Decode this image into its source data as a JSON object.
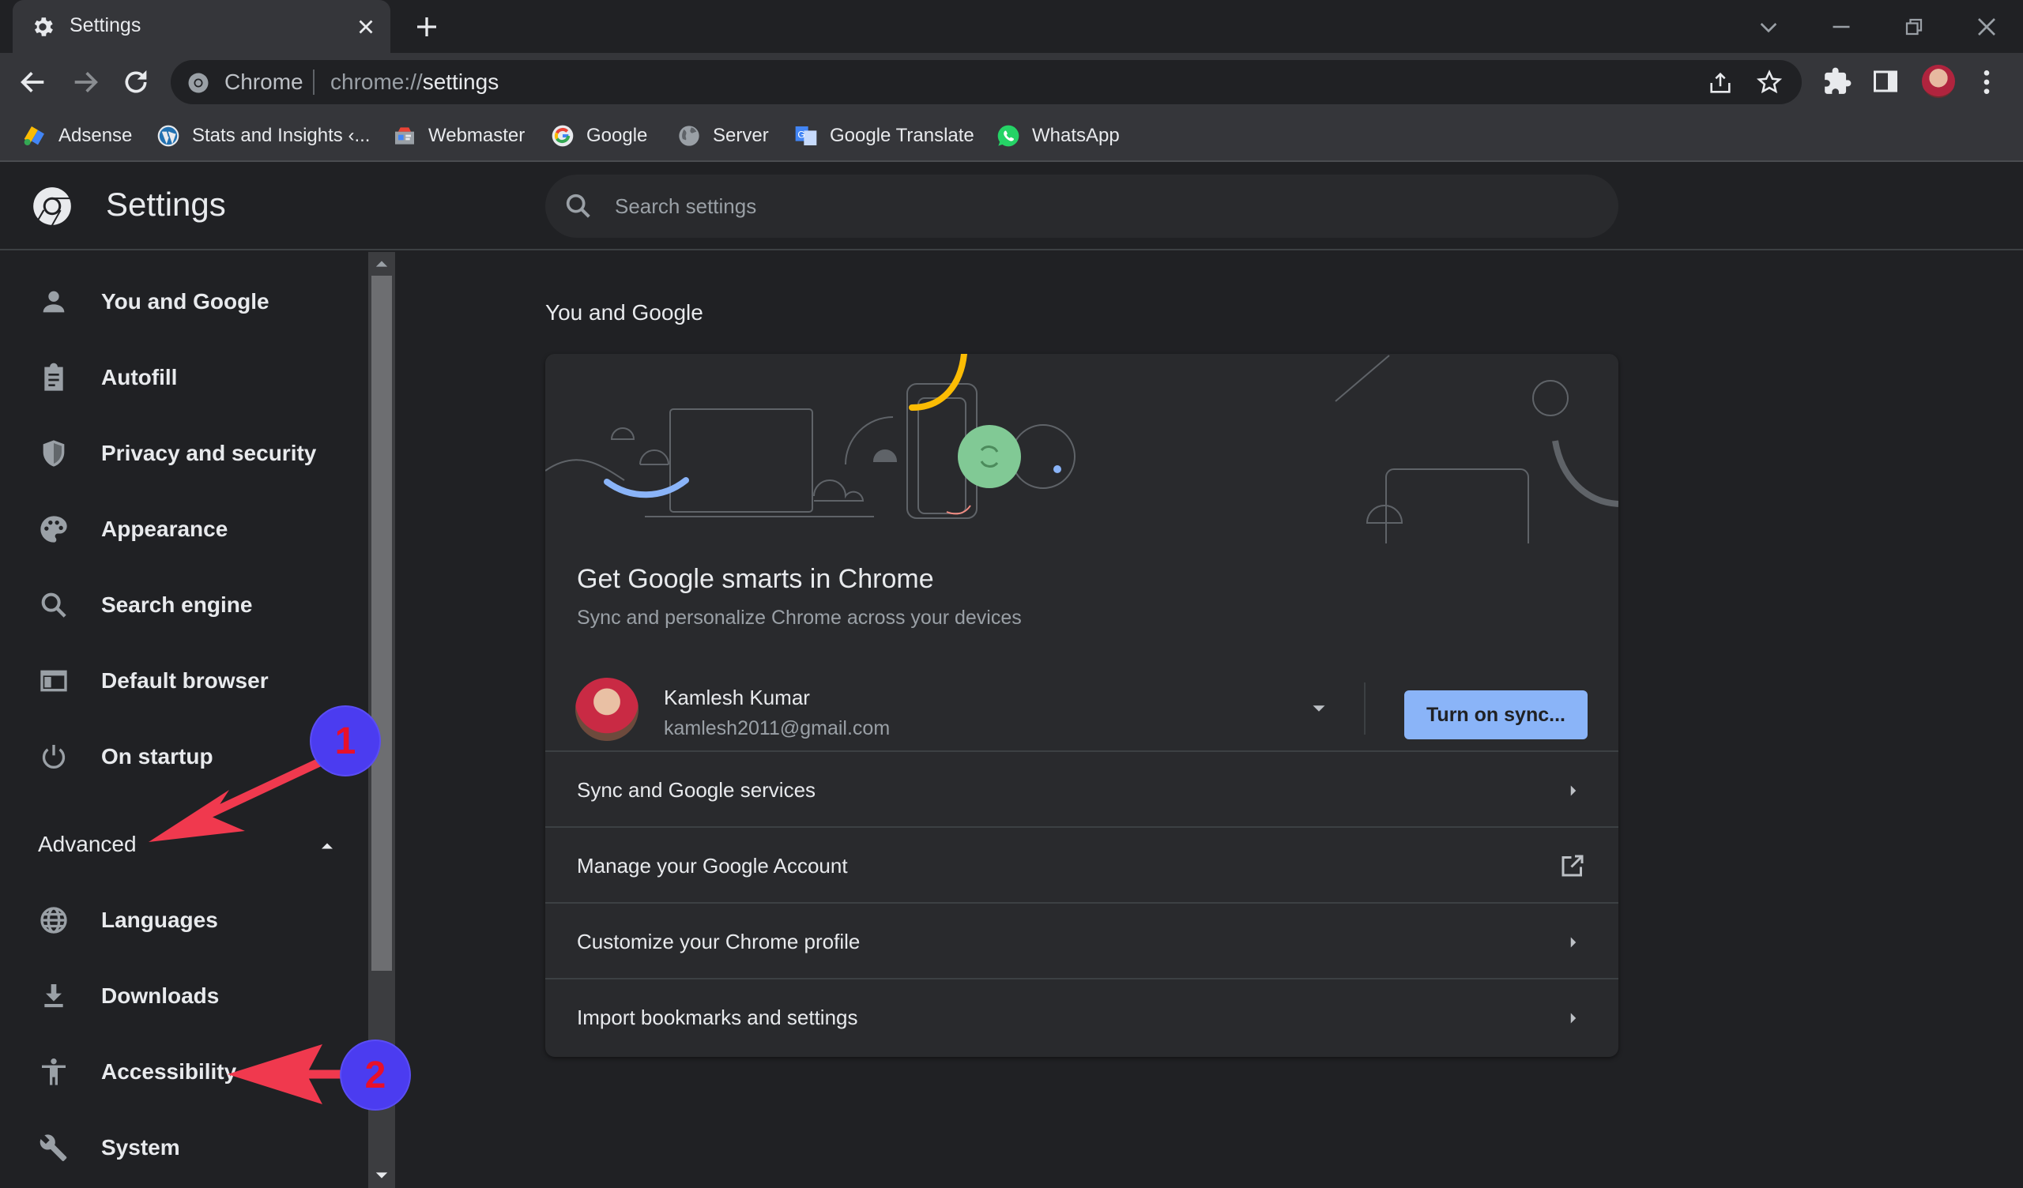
{
  "tab": {
    "title": "Settings",
    "icon": "gear-icon"
  },
  "omnibox": {
    "site_label": "Chrome",
    "url_scheme": "chrome://",
    "url_path": "settings"
  },
  "bookmarks": [
    {
      "label": "Adsense",
      "icon": "adsense-icon"
    },
    {
      "label": "Stats and Insights ‹...",
      "icon": "wordpress-icon"
    },
    {
      "label": "Webmaster",
      "icon": "webmaster-icon"
    },
    {
      "label": "Google",
      "icon": "google-icon"
    },
    {
      "label": "Server",
      "icon": "globe-icon"
    },
    {
      "label": "Google Translate",
      "icon": "translate-icon"
    },
    {
      "label": "WhatsApp",
      "icon": "whatsapp-icon"
    }
  ],
  "header": {
    "title": "Settings",
    "search_placeholder": "Search settings"
  },
  "sidebar": {
    "items": [
      {
        "label": "You and Google",
        "icon": "person-icon"
      },
      {
        "label": "Autofill",
        "icon": "clipboard-icon"
      },
      {
        "label": "Privacy and security",
        "icon": "shield-icon"
      },
      {
        "label": "Appearance",
        "icon": "palette-icon"
      },
      {
        "label": "Search engine",
        "icon": "search-icon"
      },
      {
        "label": "Default browser",
        "icon": "browser-icon"
      },
      {
        "label": "On startup",
        "icon": "power-icon"
      }
    ],
    "advanced_label": "Advanced",
    "advanced_items": [
      {
        "label": "Languages",
        "icon": "globe-icon"
      },
      {
        "label": "Downloads",
        "icon": "download-icon"
      },
      {
        "label": "Accessibility",
        "icon": "accessibility-icon"
      },
      {
        "label": "System",
        "icon": "wrench-icon"
      }
    ]
  },
  "annotations": {
    "badge_1": "1",
    "badge_2": "2"
  },
  "main": {
    "section_title": "You and Google",
    "promo_title": "Get Google smarts in Chrome",
    "promo_subtitle": "Sync and personalize Chrome across your devices",
    "account": {
      "name": "Kamlesh Kumar",
      "email": "kamlesh2011@gmail.com"
    },
    "sync_button": "Turn on sync...",
    "rows": [
      {
        "label": "Sync and Google services",
        "icon": "chevron-right-icon"
      },
      {
        "label": "Manage your Google Account",
        "icon": "open-external-icon"
      },
      {
        "label": "Customize your Chrome profile",
        "icon": "chevron-right-icon"
      },
      {
        "label": "Import bookmarks and settings",
        "icon": "chevron-right-icon"
      }
    ]
  },
  "colors": {
    "accent": "#8ab4f8",
    "background": "#202124",
    "card": "#292a2d",
    "annotation_arrow": "#f0394e",
    "annotation_badge": "#4b3cf0"
  }
}
